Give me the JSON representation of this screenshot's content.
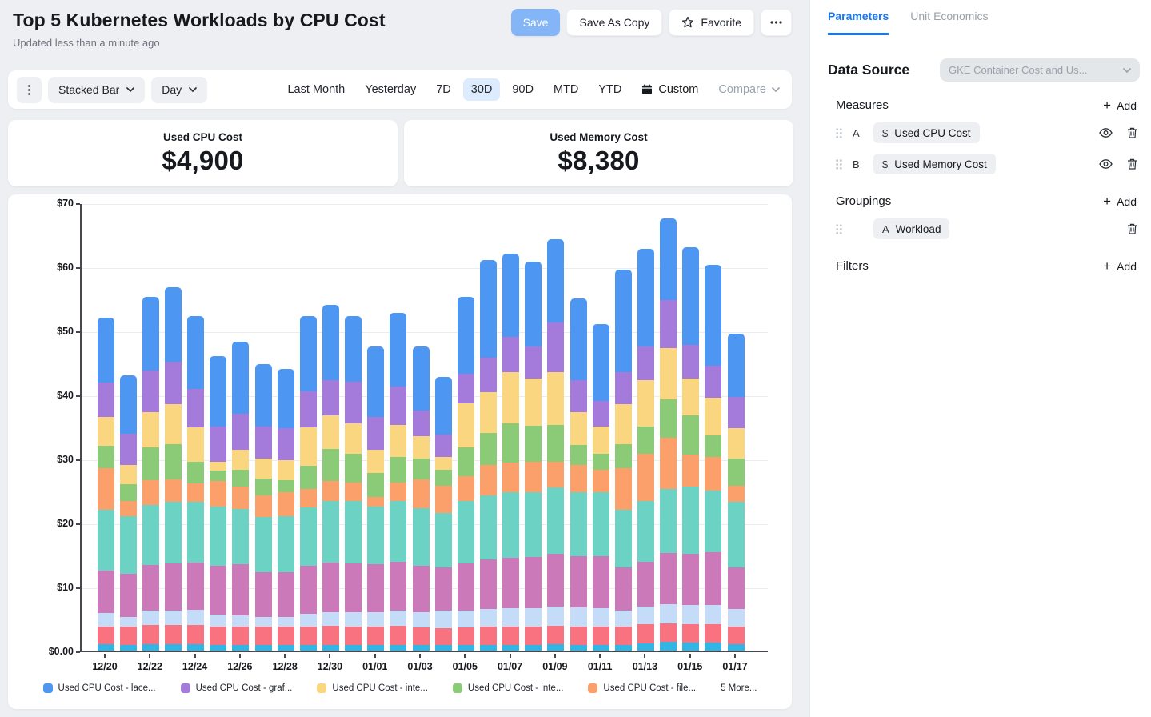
{
  "header": {
    "title": "Top 5 Kubernetes Workloads by CPU Cost",
    "updated": "Updated less than a minute ago",
    "save_label": "Save",
    "save_as_copy_label": "Save As Copy",
    "favorite_label": "Favorite"
  },
  "toolbar": {
    "chart_type": "Stacked Bar",
    "granularity": "Day",
    "ranges": [
      "Last Month",
      "Yesterday",
      "7D",
      "30D",
      "90D",
      "MTD",
      "YTD"
    ],
    "selected_range": "30D",
    "custom_label": "Custom",
    "compare_label": "Compare"
  },
  "kpis": [
    {
      "label": "Used CPU Cost",
      "value": "$4,900"
    },
    {
      "label": "Used Memory Cost",
      "value": "$8,380"
    }
  ],
  "sidebar": {
    "tabs": [
      {
        "label": "Parameters",
        "active": true
      },
      {
        "label": "Unit Economics",
        "active": false
      }
    ],
    "data_source": {
      "label": "Data Source",
      "value": "GKE Container Cost and Us..."
    },
    "measures": {
      "title": "Measures",
      "add_label": "Add",
      "items": [
        {
          "key": "A",
          "icon": "$",
          "label": "Used CPU Cost"
        },
        {
          "key": "B",
          "icon": "$",
          "label": "Used Memory Cost"
        }
      ]
    },
    "groupings": {
      "title": "Groupings",
      "add_label": "Add",
      "items": [
        {
          "icon": "A",
          "label": "Workload"
        }
      ]
    },
    "filters": {
      "title": "Filters",
      "add_label": "Add"
    }
  },
  "colors": {
    "accent_blue": "#1778f2",
    "save_button": "#83b5f7",
    "selected_range_bg": "#dcebfd"
  },
  "chart_data": {
    "type": "bar",
    "stacked": true,
    "title": "",
    "xlabel": "",
    "ylabel": "",
    "ylim": [
      0,
      70
    ],
    "ytick_step": 10,
    "ytick_labels": [
      "$0.00",
      "$10",
      "$20",
      "$30",
      "$40",
      "$50",
      "$60",
      "$70"
    ],
    "grid": true,
    "x": [
      "12/20",
      "12/21",
      "12/22",
      "12/23",
      "12/24",
      "12/25",
      "12/26",
      "12/27",
      "12/28",
      "12/29",
      "12/30",
      "12/31",
      "01/01",
      "01/02",
      "01/03",
      "01/04",
      "01/05",
      "01/06",
      "01/07",
      "01/08",
      "01/09",
      "01/10",
      "01/11",
      "01/12",
      "01/13",
      "01/14",
      "01/15",
      "01/16",
      "01/17"
    ],
    "x_labeled_every": 2,
    "legend_position": "bottom",
    "legend": [
      {
        "label": "Used CPU Cost - lace...",
        "color": "#4D97F3"
      },
      {
        "label": "Used CPU Cost - graf...",
        "color": "#A47BDB"
      },
      {
        "label": "Used CPU Cost - inte...",
        "color": "#FBD680"
      },
      {
        "label": "Used CPU Cost - inte...",
        "color": "#8BCB77"
      },
      {
        "label": "Used CPU Cost - file...",
        "color": "#FBA06A"
      },
      {
        "label": "5 More...",
        "color": null
      }
    ],
    "series": [
      {
        "name": "5 More... (segment 5)",
        "color": "#30B5E5",
        "values": [
          1.0,
          0.9,
          1.0,
          1.0,
          1.0,
          0.9,
          0.9,
          0.9,
          0.9,
          0.9,
          0.9,
          0.9,
          0.9,
          0.9,
          0.9,
          0.9,
          0.9,
          0.9,
          0.9,
          0.9,
          1.0,
          0.9,
          0.9,
          0.9,
          1.1,
          1.4,
          1.3,
          1.2,
          1.0
        ]
      },
      {
        "name": "5 More... (segment 4)",
        "color": "#F9727F",
        "values": [
          2.8,
          2.8,
          3.0,
          3.0,
          3.0,
          2.9,
          2.9,
          2.9,
          2.8,
          2.9,
          3.0,
          2.9,
          2.9,
          3.0,
          2.7,
          2.6,
          2.7,
          2.8,
          2.8,
          2.8,
          2.9,
          2.8,
          2.8,
          2.9,
          3.0,
          2.9,
          2.8,
          2.9,
          2.7
        ]
      },
      {
        "name": "5 More... (segment 3)",
        "color": "#C4DCF8",
        "values": [
          2.1,
          1.6,
          2.2,
          2.3,
          2.4,
          1.8,
          1.7,
          1.4,
          1.5,
          1.9,
          2.1,
          2.2,
          2.2,
          2.3,
          2.4,
          2.8,
          2.7,
          2.8,
          2.9,
          2.9,
          3.0,
          3.0,
          2.9,
          2.4,
          2.8,
          2.9,
          3.0,
          3.0,
          2.8
        ]
      },
      {
        "name": "5 More... (segment 2)",
        "color": "#CB79B8",
        "values": [
          6.6,
          6.7,
          7.2,
          7.3,
          7.3,
          7.6,
          8.0,
          7.1,
          7.0,
          7.6,
          7.7,
          7.6,
          7.5,
          7.7,
          7.3,
          6.7,
          7.3,
          7.7,
          7.9,
          8.0,
          8.2,
          8.0,
          8.2,
          6.8,
          7.0,
          8.0,
          8.0,
          8.3,
          6.5
        ]
      },
      {
        "name": "5 More... (segment 1)",
        "color": "#6CD2C3",
        "values": [
          9.5,
          9.0,
          9.3,
          9.6,
          9.6,
          9.3,
          8.6,
          8.6,
          8.8,
          9.1,
          9.7,
          9.8,
          9.0,
          9.5,
          9.0,
          8.5,
          9.8,
          10.0,
          10.3,
          10.2,
          10.4,
          10.0,
          9.9,
          9.0,
          9.5,
          10.1,
          10.5,
          9.6,
          10.3
        ]
      },
      {
        "name": "Used CPU Cost - file...",
        "color": "#FBA06A",
        "values": [
          6.5,
          2.4,
          3.9,
          3.5,
          2.8,
          4.0,
          3.5,
          3.3,
          3.8,
          2.9,
          3.1,
          2.8,
          1.5,
          2.9,
          4.5,
          4.3,
          3.8,
          4.8,
          4.6,
          4.7,
          4.0,
          4.3,
          3.6,
          6.5,
          7.3,
          8.0,
          5.0,
          5.2,
          2.5
        ]
      },
      {
        "name": "Used CPU Cost - inte... (2)",
        "color": "#8BCB77",
        "values": [
          3.5,
          2.6,
          5.1,
          5.5,
          3.4,
          1.6,
          2.6,
          2.7,
          1.8,
          3.6,
          5.0,
          4.6,
          3.8,
          4.0,
          3.2,
          2.5,
          4.6,
          5.0,
          6.1,
          5.6,
          5.8,
          3.1,
          2.4,
          3.8,
          4.3,
          5.9,
          6.1,
          3.4,
          4.2
        ]
      },
      {
        "name": "Used CPU Cost - inte... (1)",
        "color": "#FBD680",
        "values": [
          4.5,
          3.0,
          5.6,
          6.3,
          5.4,
          1.4,
          3.2,
          3.1,
          3.1,
          6.0,
          5.2,
          4.7,
          3.6,
          4.9,
          3.5,
          1.9,
          6.8,
          6.4,
          8.0,
          7.4,
          8.2,
          5.2,
          4.3,
          6.2,
          7.3,
          8.0,
          5.8,
          5.9,
          4.7
        ]
      },
      {
        "name": "Used CPU Cost - graf...",
        "color": "#A47BDB",
        "values": [
          5.4,
          4.9,
          6.5,
          6.6,
          6.0,
          5.5,
          5.6,
          5.0,
          5.1,
          5.6,
          5.5,
          6.5,
          5.1,
          6.0,
          4.0,
          3.6,
          4.6,
          5.4,
          5.5,
          5.0,
          7.8,
          5.0,
          4.0,
          5.0,
          5.2,
          7.6,
          5.3,
          5.0,
          4.9
        ]
      },
      {
        "name": "Used CPU Cost - lace...",
        "color": "#4D97F3",
        "values": [
          10.1,
          9.1,
          11.5,
          11.6,
          11.4,
          11.0,
          11.3,
          9.7,
          9.2,
          11.8,
          11.8,
          10.3,
          11.0,
          11.6,
          10.0,
          9.0,
          12.0,
          15.2,
          13.0,
          13.2,
          13.0,
          12.7,
          12.0,
          16.0,
          15.2,
          12.7,
          15.2,
          15.7,
          9.9
        ]
      }
    ]
  }
}
